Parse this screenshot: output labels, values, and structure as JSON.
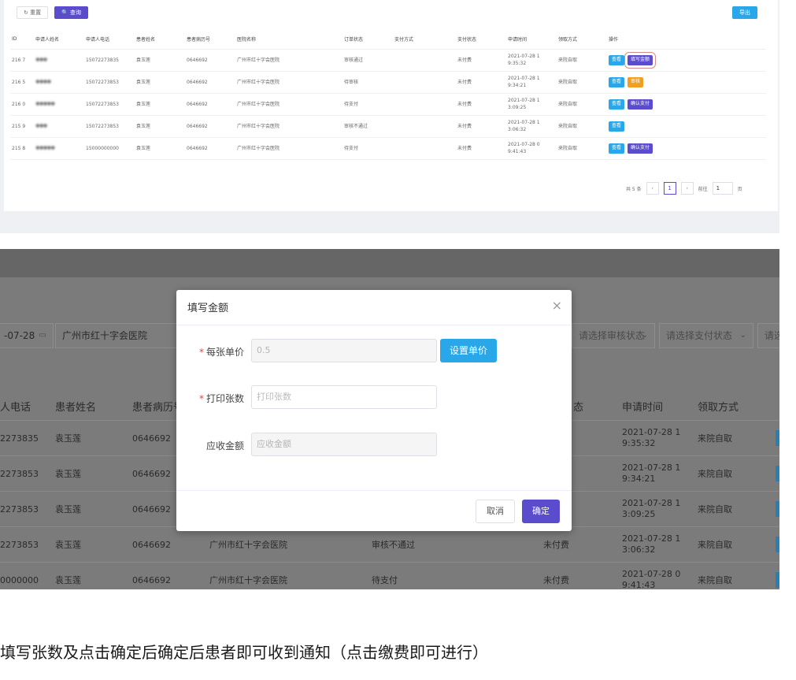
{
  "top": {
    "reset_label": "↻ 重置",
    "search_label": "🔍 查询",
    "export_label": "导出",
    "columns": [
      "ID",
      "申请人姓名",
      "申请人电话",
      "患者姓名",
      "患者病历号",
      "医院名称",
      "订单状态",
      "支付方式",
      "支付状态",
      "申请时间",
      "领取方式",
      "操作"
    ],
    "rows": [
      {
        "id": "216 7",
        "name": "※※※",
        "phone": "15072273835",
        "patient": "袁玉莲",
        "record": "0646692",
        "hospital": "广州市红十字会医院",
        "status": "审核通过",
        "pay_method": "",
        "pay_status": "未付费",
        "time": "2021-07-28 1 9:35:32",
        "pickup": "来院自取",
        "ops": [
          "查看",
          "填写金额"
        ]
      },
      {
        "id": "216 5",
        "name": "※※※※",
        "phone": "15072273853",
        "patient": "袁玉莲",
        "record": "0646692",
        "hospital": "广州市红十字会医院",
        "status": "待审核",
        "pay_method": "",
        "pay_status": "未付费",
        "time": "2021-07-28 1 9:34:21",
        "pickup": "来院自取",
        "ops": [
          "查看",
          "审核"
        ]
      },
      {
        "id": "216 0",
        "name": "※※※※※",
        "phone": "15072273853",
        "patient": "袁玉莲",
        "record": "0646692",
        "hospital": "广州市红十字会医院",
        "status": "待支付",
        "pay_method": "",
        "pay_status": "未付费",
        "time": "2021-07-28 1 3:09:25",
        "pickup": "来院自取",
        "ops": [
          "查看",
          "确认支付"
        ]
      },
      {
        "id": "215 9",
        "name": "※※※",
        "phone": "15072273853",
        "patient": "袁玉莲",
        "record": "0646692",
        "hospital": "广州市红十字会医院",
        "status": "审核不通过",
        "pay_method": "",
        "pay_status": "未付费",
        "time": "2021-07-28 1 3:06:32",
        "pickup": "来院自取",
        "ops": [
          "查看"
        ]
      },
      {
        "id": "215 8",
        "name": "※※※※※",
        "phone": "15000000000",
        "patient": "袁玉莲",
        "record": "0646692",
        "hospital": "广州市红十字会医院",
        "status": "待支付",
        "pay_method": "",
        "pay_status": "未付费",
        "time": "2021-07-28 0 9:41:43",
        "pickup": "来院自取",
        "ops": [
          "查看",
          "确认支付"
        ]
      }
    ],
    "pager": {
      "total": "共 5 条",
      "current": "1",
      "goto_label": "前往",
      "goto_value": "1",
      "page_unit": "页",
      "prev": "‹",
      "next": "›"
    }
  },
  "bottom": {
    "filters": {
      "date": "-07-28",
      "hospital": "广州市红十字会医院",
      "audit_placeholder": "请选择审核状态",
      "pay_placeholder": "请选择支付状态",
      "cut_placeholder": "请选"
    },
    "columns": [
      "人电话",
      "患者姓名",
      "患者病历号",
      "态",
      "申请时间",
      "领取方式"
    ],
    "rows": [
      {
        "phone": "2273835",
        "patient": "袁玉莲",
        "record": "0646692",
        "hospital": "",
        "status": "",
        "pay_status": "",
        "time1": "2021-07-28 1",
        "time2": "9:35:32",
        "pickup": "来院自取"
      },
      {
        "phone": "2273853",
        "patient": "袁玉莲",
        "record": "0646692",
        "hospital": "",
        "status": "",
        "pay_status": "",
        "time1": "2021-07-28 1",
        "time2": "9:34:21",
        "pickup": "来院自取"
      },
      {
        "phone": "2273853",
        "patient": "袁玉莲",
        "record": "0646692",
        "hospital": "",
        "status": "",
        "pay_status": "",
        "time1": "2021-07-28 1",
        "time2": "3:09:25",
        "pickup": "来院自取"
      },
      {
        "phone": "2273853",
        "patient": "袁玉莲",
        "record": "0646692",
        "hospital": "广州市红十字会医院",
        "status": "审核不通过",
        "pay_status": "未付费",
        "time1": "2021-07-28 1",
        "time2": "3:06:32",
        "pickup": "来院自取"
      },
      {
        "phone": "0000000",
        "patient": "袁玉莲",
        "record": "0646692",
        "hospital": "广州市红十字会医院",
        "status": "待支付",
        "pay_status": "未付费",
        "time1": "2021-07-28 0",
        "time2": "9:41:43",
        "pickup": "来院自取"
      }
    ]
  },
  "modal": {
    "title": "填写金额",
    "close": "×",
    "unit_price_label": "每张单价",
    "unit_price_value": "0.5",
    "set_price_label": "设置单价",
    "print_count_label": "打印张数",
    "print_count_placeholder": "打印张数",
    "receivable_label": "应收金额",
    "receivable_placeholder": "应收金额",
    "cancel_label": "取消",
    "confirm_label": "确定",
    "required_mark": "*"
  },
  "caption": "填写张数及点击确定后确定后患者即可收到通知（点击缴费即可进行）",
  "colors": {
    "primary": "#5b4bcd",
    "info": "#2aa7e8",
    "warning": "#f0a020",
    "danger": "#e2463b"
  }
}
